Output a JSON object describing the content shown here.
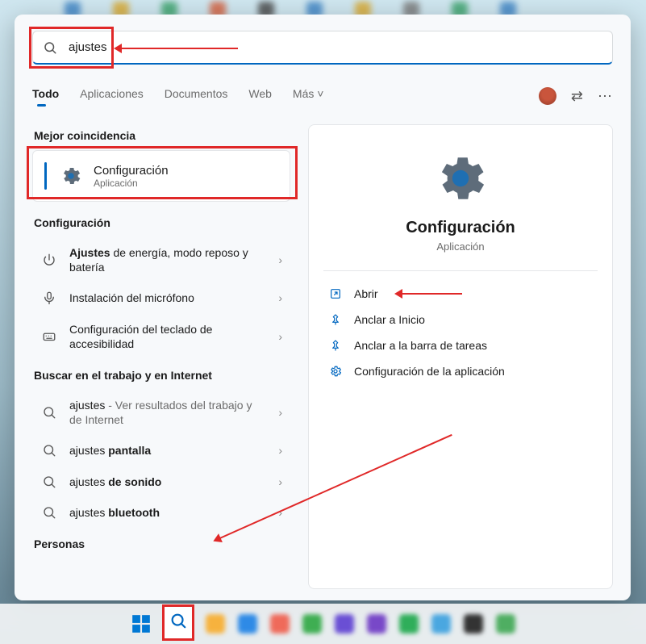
{
  "search": {
    "value": "ajustes"
  },
  "tabs": {
    "items": [
      "Todo",
      "Aplicaciones",
      "Documentos",
      "Web",
      "Más"
    ],
    "active_index": 0,
    "more_suffix": " ˅"
  },
  "sections": {
    "best_match": "Mejor coincidencia",
    "settings": "Configuración",
    "web": "Buscar en el trabajo y en Internet",
    "people": "Personas"
  },
  "best": {
    "title": "Configuración",
    "subtitle": "Aplicación"
  },
  "settings_items": [
    {
      "icon": "power",
      "html": "<span class='bold'>Ajustes</span> de energía, modo reposo y batería"
    },
    {
      "icon": "mic",
      "html": "Instalación del micrófono"
    },
    {
      "icon": "keyboard",
      "html": "Configuración del teclado de accesibilidad"
    }
  ],
  "web_items": [
    {
      "html": "ajustes <span class='light'>- Ver resultados del trabajo y de Internet</span>"
    },
    {
      "html": "ajustes <span class='bold'>pantalla</span>"
    },
    {
      "html": "ajustes <span class='bold'>de sonido</span>"
    },
    {
      "html": "ajustes <span class='bold'>bluetooth</span>"
    }
  ],
  "preview": {
    "title": "Configuración",
    "subtitle": "Aplicación",
    "actions": [
      {
        "icon": "open",
        "label": "Abrir",
        "arrow": true
      },
      {
        "icon": "pin",
        "label": "Anclar a Inicio"
      },
      {
        "icon": "pin",
        "label": "Anclar a la barra de tareas"
      },
      {
        "icon": "gear",
        "label": "Configuración de la aplicación"
      }
    ]
  },
  "taskbar_colors": [
    "#f6b23e",
    "#2e8ae6",
    "#ef6a5a",
    "#3fae52",
    "#6a4fd4",
    "#7848c8",
    "#2fae5a",
    "#4aa7e0",
    "#333333",
    "#4fae62"
  ]
}
